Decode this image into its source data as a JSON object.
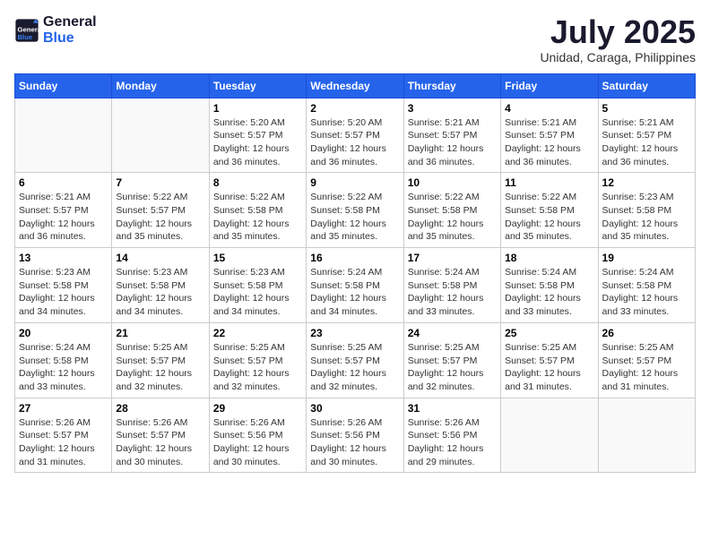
{
  "header": {
    "logo_line1": "General",
    "logo_line2": "Blue",
    "title": "July 2025",
    "subtitle": "Unidad, Caraga, Philippines"
  },
  "weekdays": [
    "Sunday",
    "Monday",
    "Tuesday",
    "Wednesday",
    "Thursday",
    "Friday",
    "Saturday"
  ],
  "weeks": [
    [
      {
        "day": "",
        "sunrise": "",
        "sunset": "",
        "daylight": ""
      },
      {
        "day": "",
        "sunrise": "",
        "sunset": "",
        "daylight": ""
      },
      {
        "day": "1",
        "sunrise": "Sunrise: 5:20 AM",
        "sunset": "Sunset: 5:57 PM",
        "daylight": "Daylight: 12 hours and 36 minutes."
      },
      {
        "day": "2",
        "sunrise": "Sunrise: 5:20 AM",
        "sunset": "Sunset: 5:57 PM",
        "daylight": "Daylight: 12 hours and 36 minutes."
      },
      {
        "day": "3",
        "sunrise": "Sunrise: 5:21 AM",
        "sunset": "Sunset: 5:57 PM",
        "daylight": "Daylight: 12 hours and 36 minutes."
      },
      {
        "day": "4",
        "sunrise": "Sunrise: 5:21 AM",
        "sunset": "Sunset: 5:57 PM",
        "daylight": "Daylight: 12 hours and 36 minutes."
      },
      {
        "day": "5",
        "sunrise": "Sunrise: 5:21 AM",
        "sunset": "Sunset: 5:57 PM",
        "daylight": "Daylight: 12 hours and 36 minutes."
      }
    ],
    [
      {
        "day": "6",
        "sunrise": "Sunrise: 5:21 AM",
        "sunset": "Sunset: 5:57 PM",
        "daylight": "Daylight: 12 hours and 36 minutes."
      },
      {
        "day": "7",
        "sunrise": "Sunrise: 5:22 AM",
        "sunset": "Sunset: 5:57 PM",
        "daylight": "Daylight: 12 hours and 35 minutes."
      },
      {
        "day": "8",
        "sunrise": "Sunrise: 5:22 AM",
        "sunset": "Sunset: 5:58 PM",
        "daylight": "Daylight: 12 hours and 35 minutes."
      },
      {
        "day": "9",
        "sunrise": "Sunrise: 5:22 AM",
        "sunset": "Sunset: 5:58 PM",
        "daylight": "Daylight: 12 hours and 35 minutes."
      },
      {
        "day": "10",
        "sunrise": "Sunrise: 5:22 AM",
        "sunset": "Sunset: 5:58 PM",
        "daylight": "Daylight: 12 hours and 35 minutes."
      },
      {
        "day": "11",
        "sunrise": "Sunrise: 5:22 AM",
        "sunset": "Sunset: 5:58 PM",
        "daylight": "Daylight: 12 hours and 35 minutes."
      },
      {
        "day": "12",
        "sunrise": "Sunrise: 5:23 AM",
        "sunset": "Sunset: 5:58 PM",
        "daylight": "Daylight: 12 hours and 35 minutes."
      }
    ],
    [
      {
        "day": "13",
        "sunrise": "Sunrise: 5:23 AM",
        "sunset": "Sunset: 5:58 PM",
        "daylight": "Daylight: 12 hours and 34 minutes."
      },
      {
        "day": "14",
        "sunrise": "Sunrise: 5:23 AM",
        "sunset": "Sunset: 5:58 PM",
        "daylight": "Daylight: 12 hours and 34 minutes."
      },
      {
        "day": "15",
        "sunrise": "Sunrise: 5:23 AM",
        "sunset": "Sunset: 5:58 PM",
        "daylight": "Daylight: 12 hours and 34 minutes."
      },
      {
        "day": "16",
        "sunrise": "Sunrise: 5:24 AM",
        "sunset": "Sunset: 5:58 PM",
        "daylight": "Daylight: 12 hours and 34 minutes."
      },
      {
        "day": "17",
        "sunrise": "Sunrise: 5:24 AM",
        "sunset": "Sunset: 5:58 PM",
        "daylight": "Daylight: 12 hours and 33 minutes."
      },
      {
        "day": "18",
        "sunrise": "Sunrise: 5:24 AM",
        "sunset": "Sunset: 5:58 PM",
        "daylight": "Daylight: 12 hours and 33 minutes."
      },
      {
        "day": "19",
        "sunrise": "Sunrise: 5:24 AM",
        "sunset": "Sunset: 5:58 PM",
        "daylight": "Daylight: 12 hours and 33 minutes."
      }
    ],
    [
      {
        "day": "20",
        "sunrise": "Sunrise: 5:24 AM",
        "sunset": "Sunset: 5:58 PM",
        "daylight": "Daylight: 12 hours and 33 minutes."
      },
      {
        "day": "21",
        "sunrise": "Sunrise: 5:25 AM",
        "sunset": "Sunset: 5:57 PM",
        "daylight": "Daylight: 12 hours and 32 minutes."
      },
      {
        "day": "22",
        "sunrise": "Sunrise: 5:25 AM",
        "sunset": "Sunset: 5:57 PM",
        "daylight": "Daylight: 12 hours and 32 minutes."
      },
      {
        "day": "23",
        "sunrise": "Sunrise: 5:25 AM",
        "sunset": "Sunset: 5:57 PM",
        "daylight": "Daylight: 12 hours and 32 minutes."
      },
      {
        "day": "24",
        "sunrise": "Sunrise: 5:25 AM",
        "sunset": "Sunset: 5:57 PM",
        "daylight": "Daylight: 12 hours and 32 minutes."
      },
      {
        "day": "25",
        "sunrise": "Sunrise: 5:25 AM",
        "sunset": "Sunset: 5:57 PM",
        "daylight": "Daylight: 12 hours and 31 minutes."
      },
      {
        "day": "26",
        "sunrise": "Sunrise: 5:25 AM",
        "sunset": "Sunset: 5:57 PM",
        "daylight": "Daylight: 12 hours and 31 minutes."
      }
    ],
    [
      {
        "day": "27",
        "sunrise": "Sunrise: 5:26 AM",
        "sunset": "Sunset: 5:57 PM",
        "daylight": "Daylight: 12 hours and 31 minutes."
      },
      {
        "day": "28",
        "sunrise": "Sunrise: 5:26 AM",
        "sunset": "Sunset: 5:57 PM",
        "daylight": "Daylight: 12 hours and 30 minutes."
      },
      {
        "day": "29",
        "sunrise": "Sunrise: 5:26 AM",
        "sunset": "Sunset: 5:56 PM",
        "daylight": "Daylight: 12 hours and 30 minutes."
      },
      {
        "day": "30",
        "sunrise": "Sunrise: 5:26 AM",
        "sunset": "Sunset: 5:56 PM",
        "daylight": "Daylight: 12 hours and 30 minutes."
      },
      {
        "day": "31",
        "sunrise": "Sunrise: 5:26 AM",
        "sunset": "Sunset: 5:56 PM",
        "daylight": "Daylight: 12 hours and 29 minutes."
      },
      {
        "day": "",
        "sunrise": "",
        "sunset": "",
        "daylight": ""
      },
      {
        "day": "",
        "sunrise": "",
        "sunset": "",
        "daylight": ""
      }
    ]
  ]
}
